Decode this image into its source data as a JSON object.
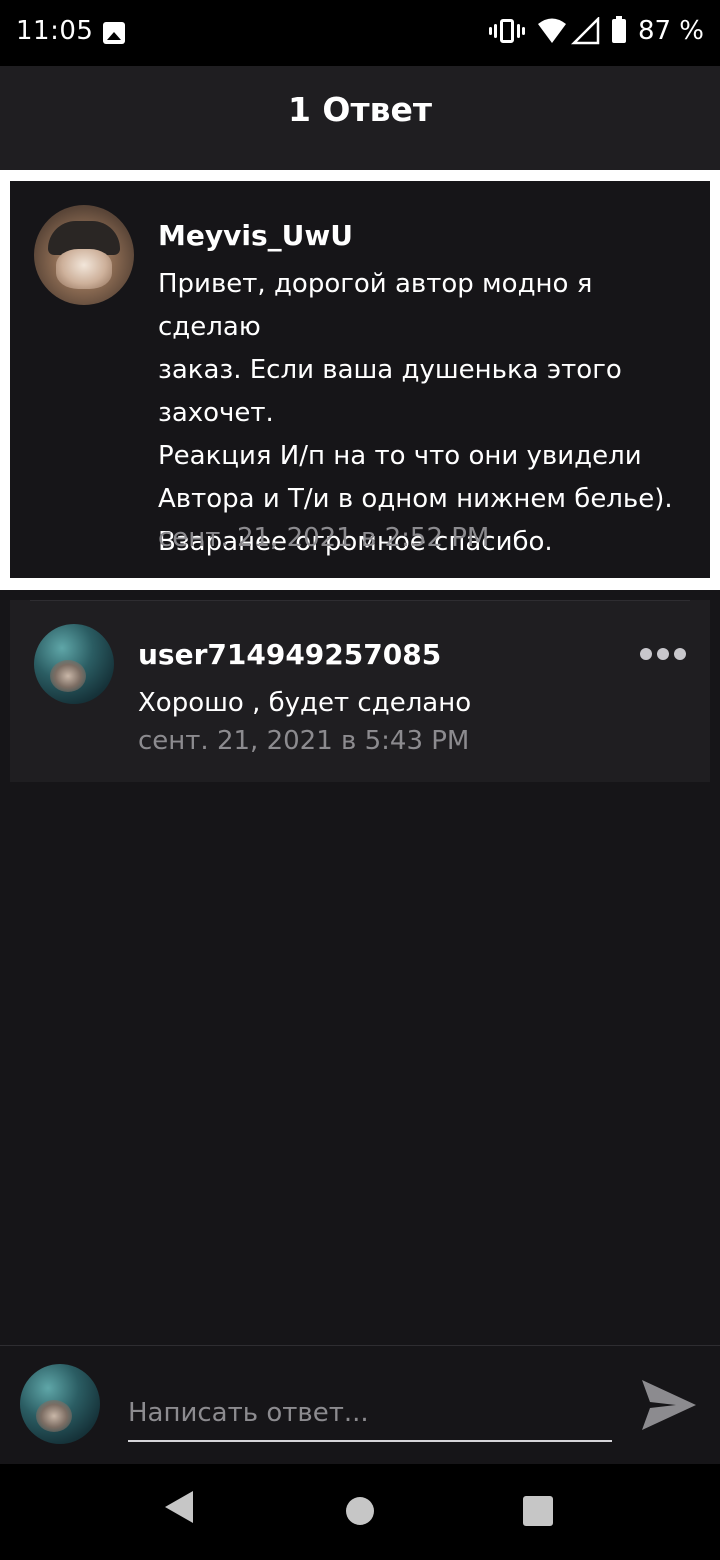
{
  "status_bar": {
    "time": "11:05",
    "battery": "87 %",
    "icons": [
      "gallery-icon",
      "vibrate-icon",
      "wifi-icon",
      "signal-icon",
      "battery-icon"
    ]
  },
  "header": {
    "title": "1 Ответ"
  },
  "original_comment": {
    "author": "Meyvis_UwU",
    "text_lines": [
      "Привет, дорогой автор модно я сделаю",
      "заказ. Если ваша душенька этого",
      "захочет.",
      "Реакция И/п на то что они увидели",
      "Автора и Т/и в одном нижнем белье).",
      "Взаранее огромное спасибо."
    ],
    "timestamp": "сент. 21, 2021 в 2:52 PM"
  },
  "replies": [
    {
      "author": "user714949257085",
      "text": "Хорошо , будет сделано",
      "timestamp": "сент. 21, 2021 в 5:43 PM"
    }
  ],
  "composer": {
    "placeholder": "Написать ответ..."
  },
  "colors": {
    "background": "#161518",
    "app_bar": "#1f1e21",
    "muted_text": "#8c8b8f",
    "highlight_border": "#ffffff"
  }
}
